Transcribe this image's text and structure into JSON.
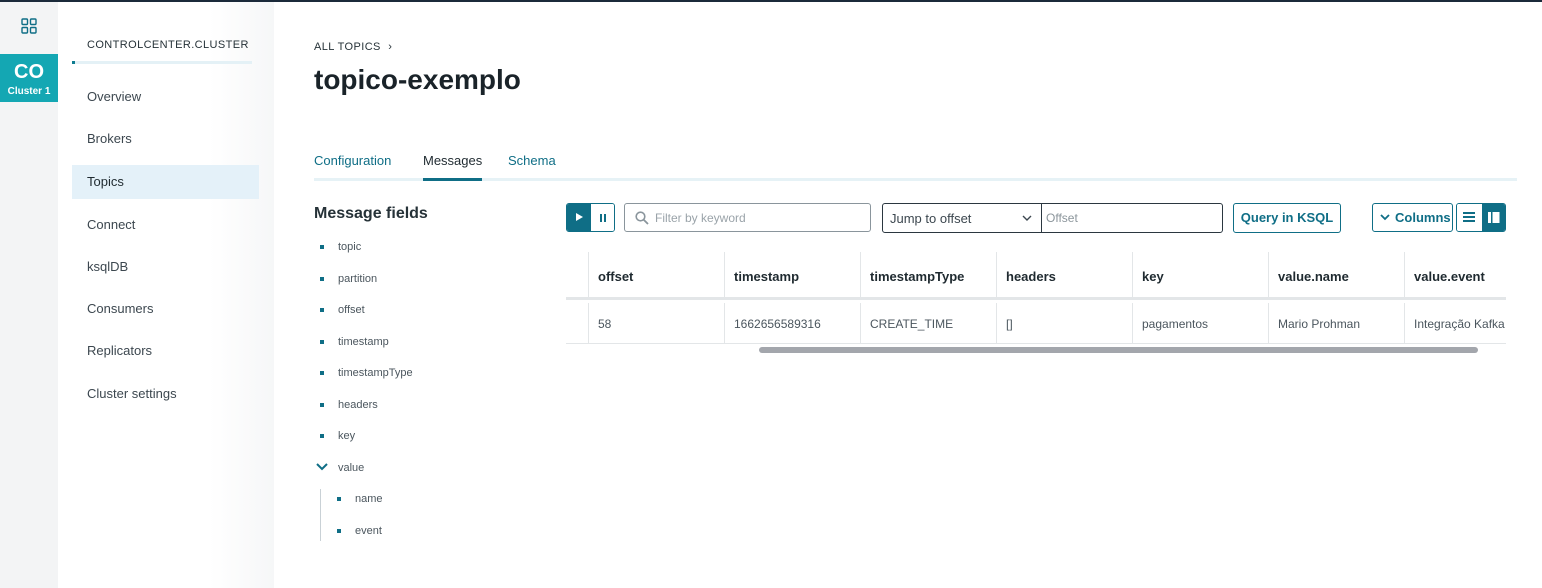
{
  "rail": {
    "cluster_abbr": "CO",
    "cluster_label": "Cluster 1"
  },
  "sidebar": {
    "cluster_name": "CONTROLCENTER.CLUSTER",
    "items": [
      {
        "label": "Overview"
      },
      {
        "label": "Brokers"
      },
      {
        "label": "Topics",
        "active": true
      },
      {
        "label": "Connect"
      },
      {
        "label": "ksqlDB"
      },
      {
        "label": "Consumers"
      },
      {
        "label": "Replicators"
      },
      {
        "label": "Cluster settings"
      }
    ]
  },
  "header": {
    "breadcrumb": "ALL TOPICS",
    "title": "topico-exemplo"
  },
  "tabs": [
    {
      "label": "Configuration"
    },
    {
      "label": "Messages",
      "active": true
    },
    {
      "label": "Schema"
    }
  ],
  "message_fields": {
    "title": "Message fields",
    "fields": [
      "topic",
      "partition",
      "offset",
      "timestamp",
      "timestampType",
      "headers",
      "key"
    ],
    "value_group": "value",
    "value_children": [
      "name",
      "event"
    ]
  },
  "toolbar": {
    "search_placeholder": "Filter by keyword",
    "jump_label": "Jump to offset",
    "offset_placeholder": "Offset",
    "ksql_label": "Query in KSQL",
    "columns_label": "Columns"
  },
  "table": {
    "columns": [
      "offset",
      "timestamp",
      "timestampType",
      "headers",
      "key",
      "value.name",
      "value.event"
    ],
    "rows": [
      [
        "58",
        "1662656589316",
        "CREATE_TIME",
        "[]",
        "pagamentos",
        "Mario Prohman",
        "Integração Kafka"
      ]
    ]
  },
  "colors": {
    "accent": "#0f6e86",
    "cluster_tile": "#14a7b3",
    "active_nav_bg": "#e4f1f9"
  }
}
